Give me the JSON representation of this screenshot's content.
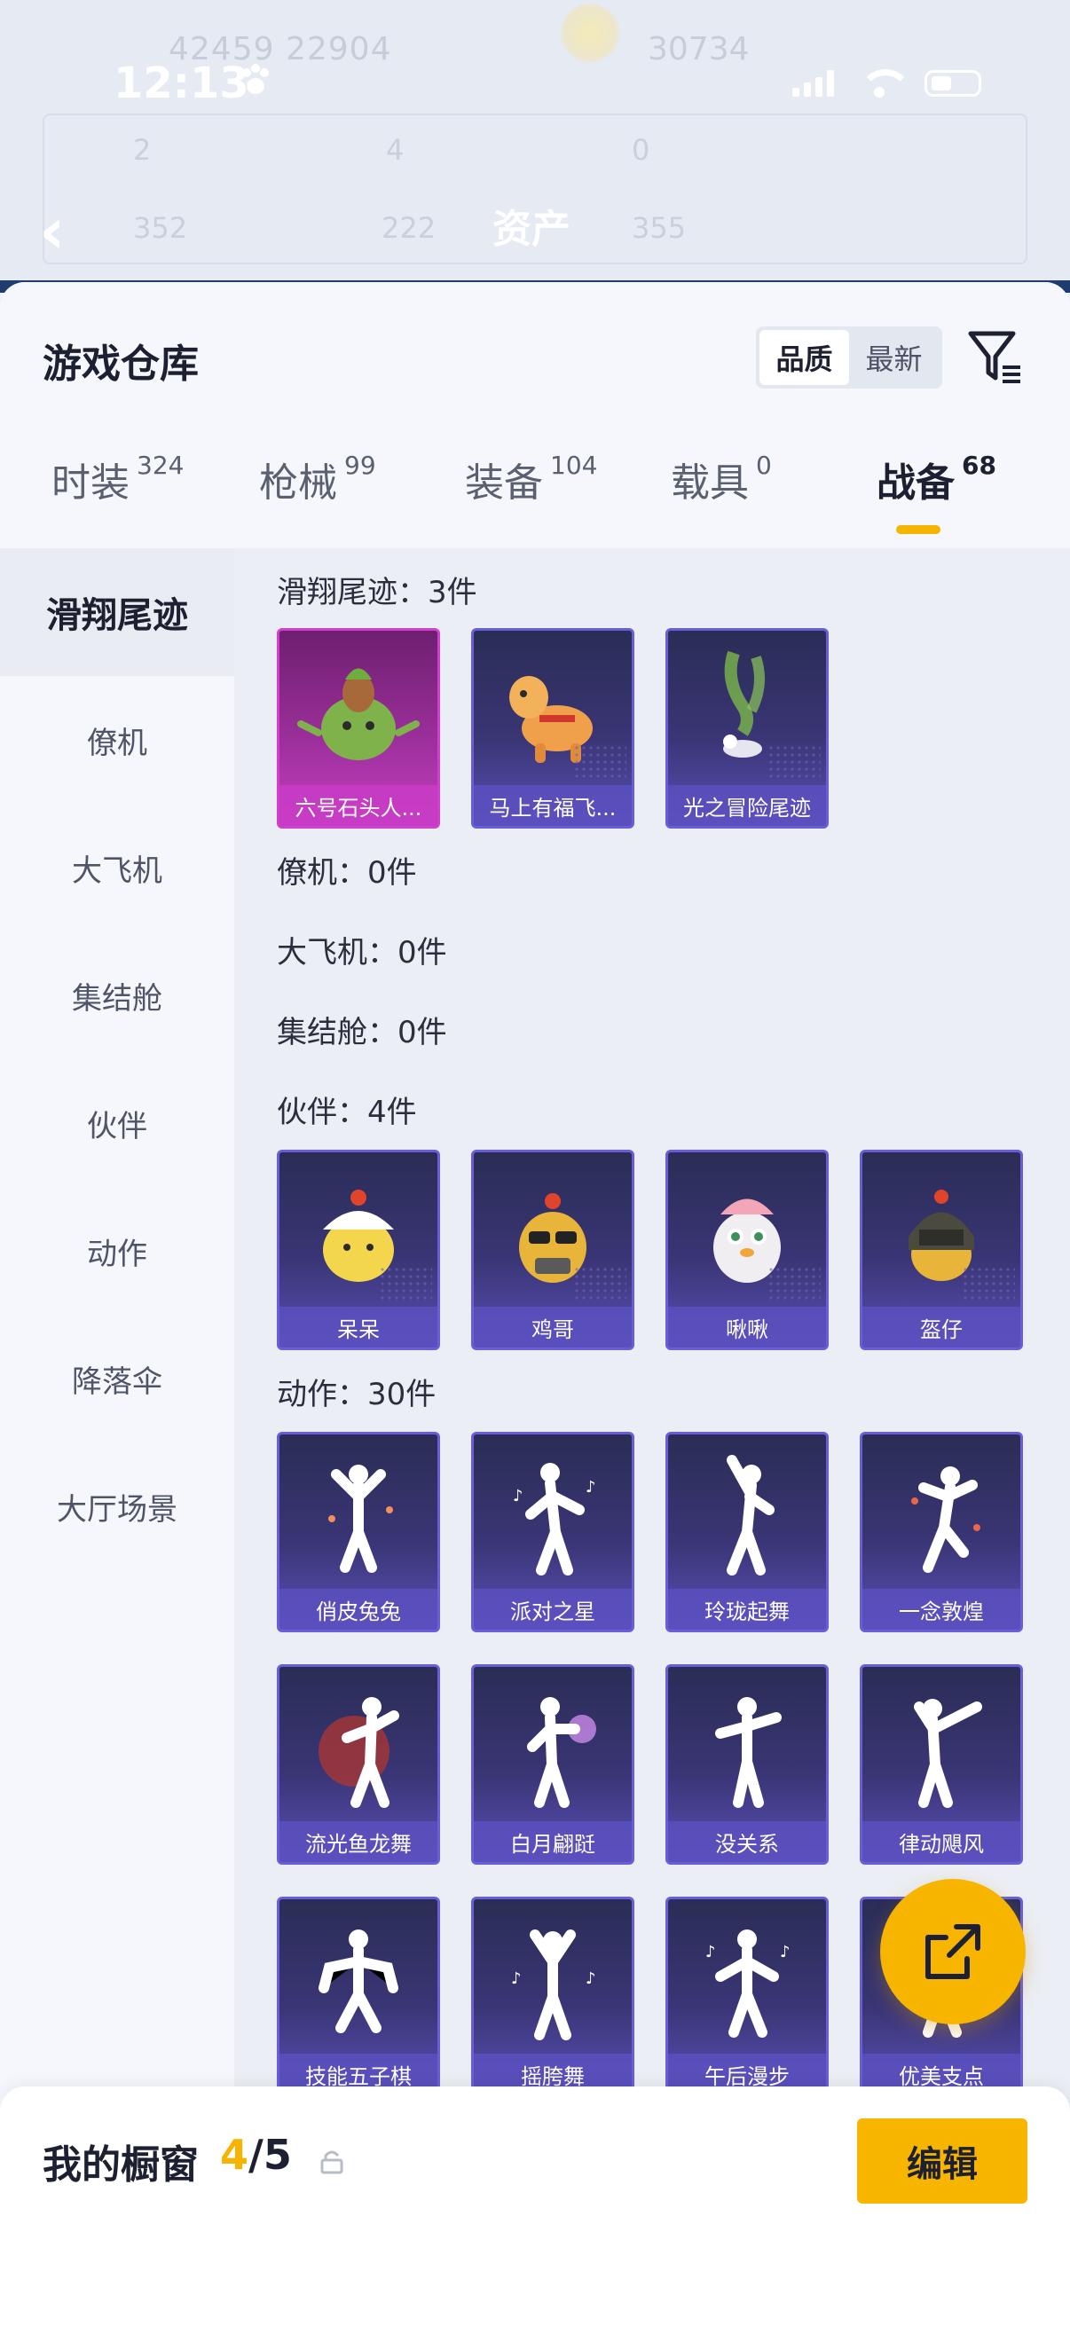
{
  "status_bar": {
    "time": "12:13",
    "paw_icon": "paw-icon"
  },
  "background": {
    "ghost_left": "42459   22904",
    "ghost_right": "30734",
    "stats": [
      "2",
      "4",
      "0",
      "352",
      "222",
      "355"
    ],
    "title": "资产"
  },
  "sheet": {
    "title": "游戏仓库",
    "sort_options": [
      "品质",
      "最新"
    ],
    "active_sort": "品质"
  },
  "tabs": [
    {
      "label": "时装",
      "count": "324"
    },
    {
      "label": "枪械",
      "count": "99"
    },
    {
      "label": "装备",
      "count": "104"
    },
    {
      "label": "载具",
      "count": "0"
    },
    {
      "label": "战备",
      "count": "68",
      "active": true
    }
  ],
  "categories": [
    "滑翔尾迹",
    "僚机",
    "大飞机",
    "集结舱",
    "伙伴",
    "动作",
    "降落伞",
    "大厅场景"
  ],
  "sections": {
    "trail": {
      "title": "滑翔尾迹：3件",
      "items": [
        "六号石头人...",
        "马上有福飞...",
        "光之冒险尾迹"
      ]
    },
    "wingman": {
      "title": "僚机：0件"
    },
    "bigplane": {
      "title": "大飞机：0件"
    },
    "assembly": {
      "title": "集结舱：0件"
    },
    "partner": {
      "title": "伙伴：4件",
      "items": [
        "呆呆",
        "鸡哥",
        "啾啾",
        "盔仔"
      ]
    },
    "emote": {
      "title": "动作：30件",
      "items": [
        "俏皮兔兔",
        "派对之星",
        "玲珑起舞",
        "一念敦煌",
        "流光鱼龙舞",
        "白月翩跹",
        "没关系",
        "律动飓风",
        "技能五子棋",
        "摇胯舞",
        "午后漫步",
        "优美支点"
      ]
    }
  },
  "bottom": {
    "title": "我的橱窗",
    "current": "4",
    "total": "/5",
    "edit_label": "编辑"
  },
  "colors": {
    "accent": "#f7b500",
    "card_purple": "#5a4fb6",
    "card_pink": "#c43fc1"
  }
}
